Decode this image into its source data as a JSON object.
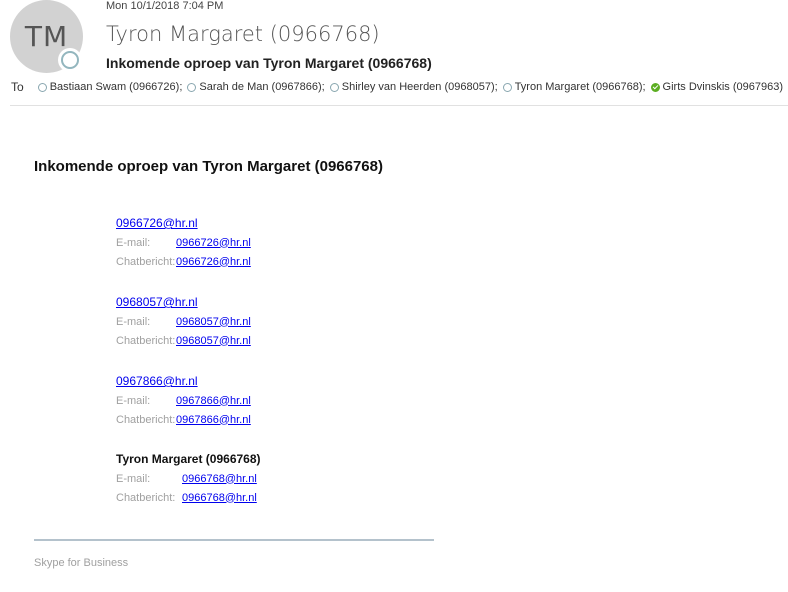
{
  "header": {
    "avatar_initials": "TM",
    "date": "Mon 10/1/2018 7:04 PM",
    "sender": "Tyron Margaret (0966768)",
    "subject": "Inkomende oproep van Tyron Margaret (0966768)"
  },
  "to": {
    "label": "To",
    "recipients": [
      {
        "name": "Bastiaan Swam (0966726);",
        "status": "offline"
      },
      {
        "name": "Sarah de Man (0967866);",
        "status": "offline"
      },
      {
        "name": "Shirley van Heerden (0968057);",
        "status": "offline"
      },
      {
        "name": "Tyron Margaret (0966768);",
        "status": "offline"
      },
      {
        "name": "Girts Dvinskis (0967963)",
        "status": "available"
      }
    ]
  },
  "body": {
    "title": "Inkomende oproep van Tyron Margaret (0966768)",
    "contacts": [
      {
        "heading": "0966726@hr.nl",
        "email_label": "E-mail:",
        "email": "0966726@hr.nl",
        "chat_label": "Chatbericht:",
        "chat": "0966726@hr.nl"
      },
      {
        "heading": "0968057@hr.nl",
        "email_label": "E-mail:",
        "email": "0968057@hr.nl",
        "chat_label": "Chatbericht:",
        "chat": "0968057@hr.nl"
      },
      {
        "heading": "0967866@hr.nl",
        "email_label": "E-mail:",
        "email": "0967866@hr.nl",
        "chat_label": "Chatbericht:",
        "chat": "0967866@hr.nl"
      },
      {
        "heading": "Tyron Margaret (0966768)",
        "email_label": "E-mail:",
        "email": "0966768@hr.nl",
        "chat_label": "Chatbericht:",
        "chat": "0966768@hr.nl"
      }
    ],
    "footer": "Skype for Business"
  },
  "colors": {
    "link": "#0000ee",
    "available": "#5cae22",
    "label_gray": "#a0a0a0"
  }
}
